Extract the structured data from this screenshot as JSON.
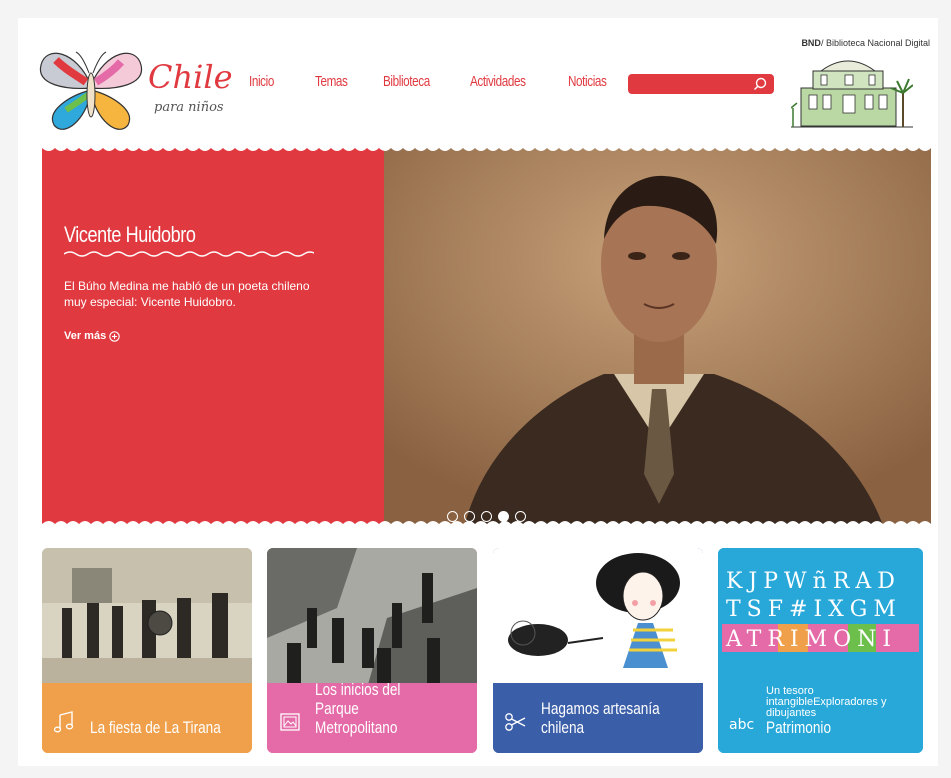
{
  "brand": {
    "title": "Chile",
    "subtitle": "para niños"
  },
  "nav": {
    "items": [
      {
        "label": "Inicio"
      },
      {
        "label": "Temas"
      },
      {
        "label": "Biblioteca"
      },
      {
        "label": "Actividades"
      },
      {
        "label": "Noticias"
      }
    ]
  },
  "search": {
    "placeholder": "",
    "icon": "search-icon"
  },
  "bnd": {
    "bold": "BND",
    "rest": "/ Biblioteca Nacional Digital"
  },
  "hero": {
    "title": "Vicente Huidobro",
    "text": "El Búho Medina me habló de un poeta chileno muy especial: Vicente Huidobro.",
    "more": "Ver más",
    "slides": 5,
    "active_slide": 4
  },
  "cards": [
    {
      "title": "La fiesta de La Tirana",
      "icon": "music-note-icon",
      "color": "#f0a04b"
    },
    {
      "title": "Los inicios del Parque Metropolitano",
      "icon": "image-icon",
      "color": "#e56ba8"
    },
    {
      "title": "Hagamos artesanía chilena",
      "icon": "scissors-icon",
      "color": "#3b5ea8"
    },
    {
      "title": "Patrimonio",
      "pre": "Un tesoro intangibleExploradores y dibujantes",
      "icon": "abc-icon",
      "color": "#27a8d9"
    }
  ],
  "colors": {
    "accent": "#e0393f",
    "orange": "#f0a04b",
    "pink": "#e56ba8",
    "blue": "#3b5ea8",
    "cyan": "#27a8d9"
  },
  "patrimonio_letters": {
    "row1": "KJPWñRAD",
    "row2": "TSF#IXGM",
    "row3": "ATRIMONI"
  }
}
